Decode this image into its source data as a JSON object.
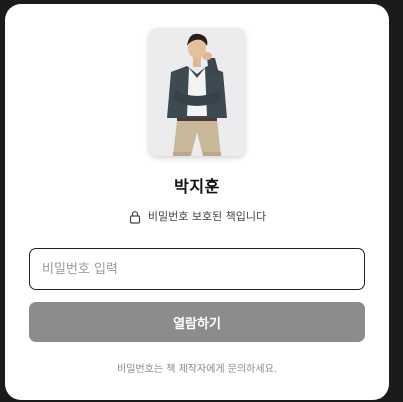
{
  "book": {
    "title": "박지훈",
    "cover_image": "author-portrait"
  },
  "protect": {
    "icon": "lock-icon",
    "text": "비밀번호 보호된 책입니다"
  },
  "password": {
    "placeholder": "비밀번호 입력",
    "value": ""
  },
  "open_button": {
    "label": "열람하기",
    "color": "#8c8c8c"
  },
  "help_text": "비밀번호는 책 제작자에게 문의하세요."
}
